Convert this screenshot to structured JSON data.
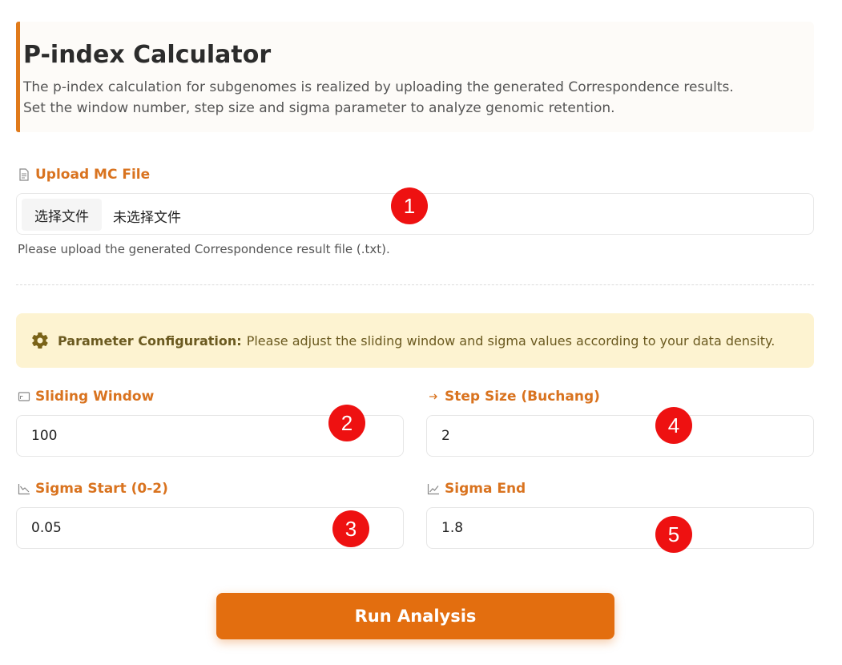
{
  "header": {
    "title": "P-index Calculator",
    "description": "The p-index calculation for subgenomes is realized by uploading the generated Correspondence results. Set the window number, step size and sigma parameter to analyze genomic retention."
  },
  "upload": {
    "label": "Upload MC File",
    "button_label": "选择文件",
    "status": "未选择文件",
    "hint": "Please upload the generated Correspondence result file (.txt)."
  },
  "params_notice": {
    "title": "Parameter Configuration:",
    "text": "Please adjust the sliding window and sigma values according to your data density."
  },
  "fields": {
    "sliding_window": {
      "label": "Sliding Window",
      "value": "100"
    },
    "step_size": {
      "label": "Step Size (Buchang)",
      "value": "2"
    },
    "sigma_start": {
      "label": "Sigma Start (0-2)",
      "value": "0.05"
    },
    "sigma_end": {
      "label": "Sigma End",
      "value": "1.8"
    }
  },
  "markers": [
    "1",
    "2",
    "3",
    "4",
    "5"
  ],
  "run_button": "Run Analysis",
  "colors": {
    "accent": "#e36e0f",
    "label": "#d9731f",
    "notice_bg": "#fdf3d1",
    "marker": "#ee1111"
  }
}
